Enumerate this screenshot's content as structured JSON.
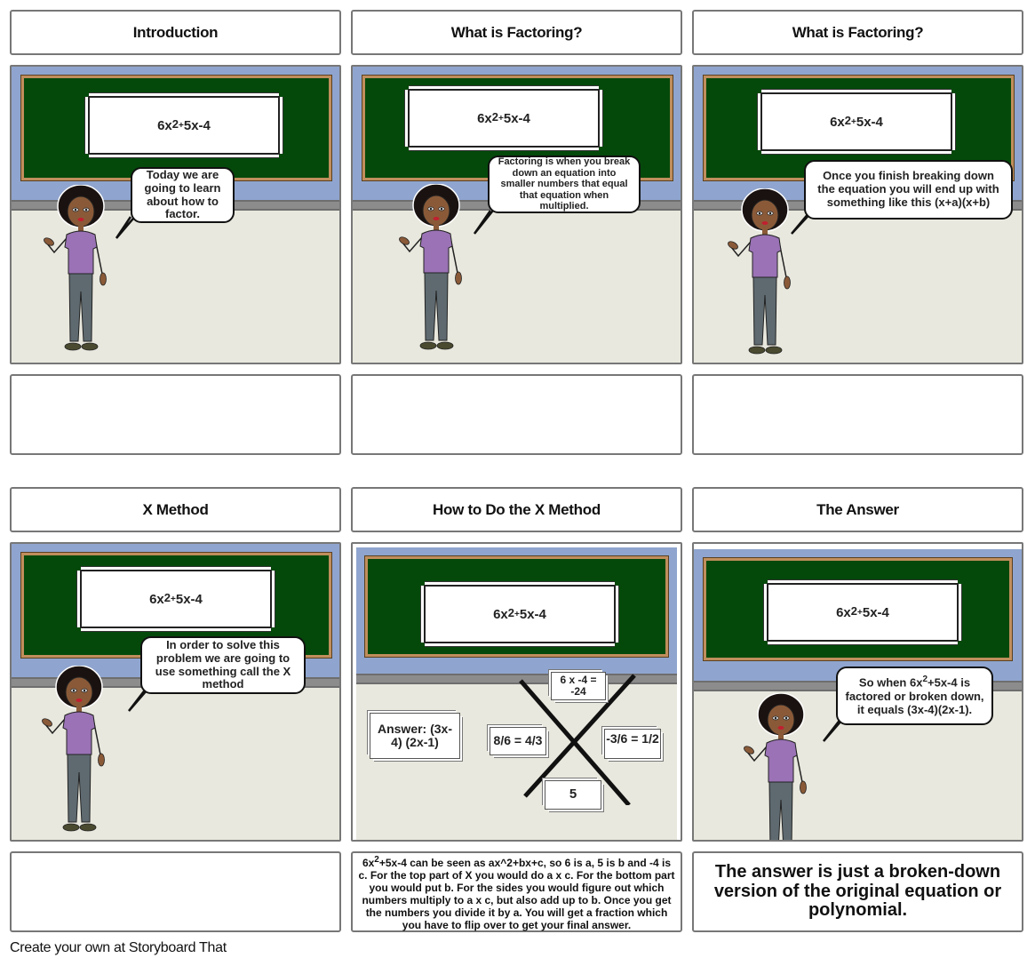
{
  "storyboard": {
    "rows": [
      {
        "cells": [
          {
            "title": "Introduction",
            "equation": {
              "base": "6x",
              "exp": "2",
              "op": "+",
              "rest": "5x-4"
            },
            "speech": "Today we are going to learn about how to factor.",
            "caption": ""
          },
          {
            "title": "What is Factoring?",
            "equation": {
              "base": "6x",
              "exp": "2",
              "op": "+",
              "rest": "5x-4"
            },
            "speech": "Factoring is when you break down an equation into smaller numbers that equal that equation when multiplied.",
            "caption": ""
          },
          {
            "title": "What is Factoring?",
            "equation": {
              "base": "6x",
              "exp": "2",
              "op": "+",
              "rest": "5x-4"
            },
            "speech": "Once you finish breaking down the equation you will end up with something like this (x+a)(x+b)",
            "caption": ""
          }
        ]
      },
      {
        "cells": [
          {
            "title": "X Method",
            "equation": {
              "base": "6x",
              "exp": "2",
              "op": "+",
              "rest": "5x-4"
            },
            "speech": "In order to solve this problem we are going to use something call the X method",
            "caption": ""
          },
          {
            "title": "How to Do the X Method",
            "equation": {
              "base": "6x",
              "exp": "2",
              "op": "+",
              "rest": "5x-4"
            },
            "x_method": {
              "top": "6 x -4 = -24",
              "left": "8/6 = 4/3",
              "right": "-3/6 = 1/2",
              "bottom": "5",
              "answer": "Answer: (3x-4) (2x-1)"
            },
            "caption_parts": {
              "base": "6x",
              "exp": "2",
              "rest": "+5x-4 can be seen as ax^2+bx+c, so 6 is a, 5 is b and -4 is c. For the top part of X you would do a x c. For the bottom part you would put b. For the sides you would figure out which numbers multiply to a x c, but also add up to b. Once you get the numbers you divide it by a. You will get a fraction which you have to flip over to get your final answer."
            }
          },
          {
            "title": "The Answer",
            "equation": {
              "base": "6x",
              "exp": "2",
              "op": "+",
              "rest": "5x-4"
            },
            "speech_parts": {
              "pre": "So when 6x",
              "exp": "2",
              "post": "+5x-4 is factored or broken down, it equals (3x-4)(2x-1)."
            },
            "caption": "The answer is just a broken-down version of the original equation or polynomial."
          }
        ]
      }
    ]
  },
  "footer": {
    "text": "Create your own at Storyboard That"
  },
  "colors": {
    "wall": "#8fa5cf",
    "board": "#04490a",
    "board_frame": "#c08e5c",
    "floor": "#e9e8de",
    "shirt": "#9a72b5",
    "pants": "#5e6a70"
  }
}
